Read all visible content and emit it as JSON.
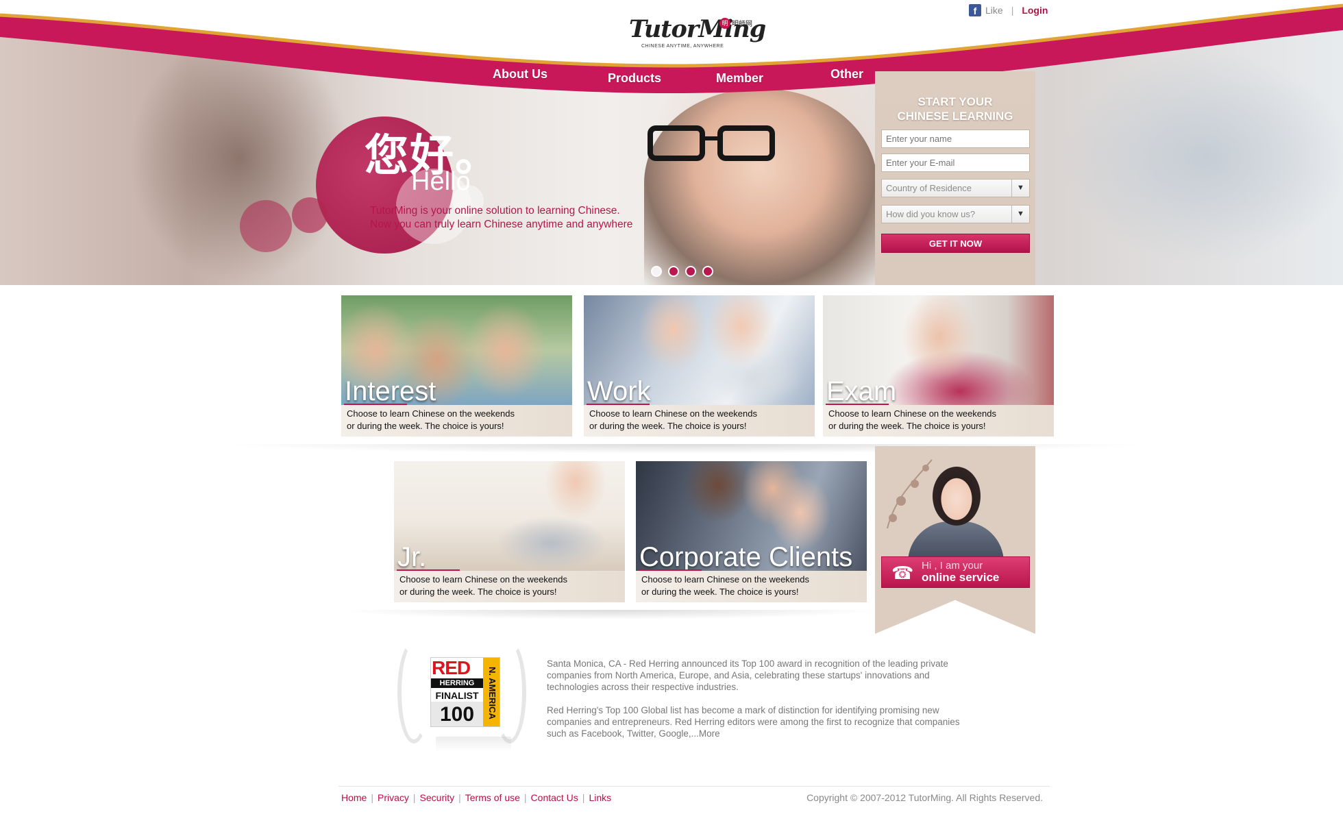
{
  "brand": {
    "logo_text": "TutorMing",
    "logo_sub": "CHINESE ANYTIME, ANYWHERE",
    "logo_badge": "明",
    "logo_cn": "明師网"
  },
  "topbar": {
    "like_label": "Like",
    "login_label": "Login"
  },
  "nav": {
    "items": [
      "About Us",
      "Products",
      "Member",
      "Other"
    ]
  },
  "hero": {
    "greeting_cn": "您好。",
    "greeting_en": "Hello",
    "tagline_1": "TutorMing is your online solution to learning Chinese.",
    "tagline_2": "Now you can truly learn Chinese anytime and anywhere"
  },
  "signup": {
    "title_1": "START YOUR",
    "title_2": "CHINESE LEARNING",
    "name_placeholder": "Enter your name",
    "email_placeholder": "Enter your E-mail",
    "country_label": "Country of Residence",
    "source_label": "How did you know us?",
    "submit_label": "GET IT NOW"
  },
  "cards": [
    {
      "title": "Interest",
      "line_1": "Choose to learn Chinese on the weekends",
      "line_2": "or during the week. The choice is yours!"
    },
    {
      "title": "Work",
      "line_1": "Choose to learn Chinese on the weekends",
      "line_2": "or during the week. The choice is yours!"
    },
    {
      "title": "Exam",
      "line_1": "Choose to learn Chinese on the weekends",
      "line_2": "or during the week. The choice is yours!"
    },
    {
      "title": "Jr.",
      "line_1": "Choose to learn Chinese on the weekends",
      "line_2": "or during the week. The choice is yours!"
    },
    {
      "title": "Corporate Clients",
      "line_1": "Choose to learn Chinese on the weekends",
      "line_2": "or during the week. The choice is yours!"
    }
  ],
  "service": {
    "line_1": "Hi , I am your",
    "line_2": "online service"
  },
  "award": {
    "rh_red": "RED",
    "rh_herring": "HERRING",
    "rh_finalist": "FINALIST",
    "rh_number": "100",
    "rh_region": "N. AMERICA"
  },
  "news": {
    "para_1": "Santa Monica, CA - Red Herring announced its Top 100 award in recognition of the leading private companies from North America, Europe, and Asia, celebrating these startups' innovations and technologies across their respective industries.",
    "para_2": "Red Herring's Top 100 Global list has become a mark of distinction for identifying promising new companies and entrepreneurs. Red Herring editors were among the first to recognize that companies such as Facebook, Twitter, Google,...",
    "more_label": "More"
  },
  "footer": {
    "links": [
      "Home",
      "Privacy",
      "Security",
      "Terms of use",
      "Contact Us",
      "Links"
    ],
    "copyright": "Copyright © 2007-2012 TutorMing. All Rights Reserved."
  },
  "colors": {
    "brand": "#b80f45",
    "accent_gold": "#e0a032",
    "panel": "#dccdc0"
  }
}
